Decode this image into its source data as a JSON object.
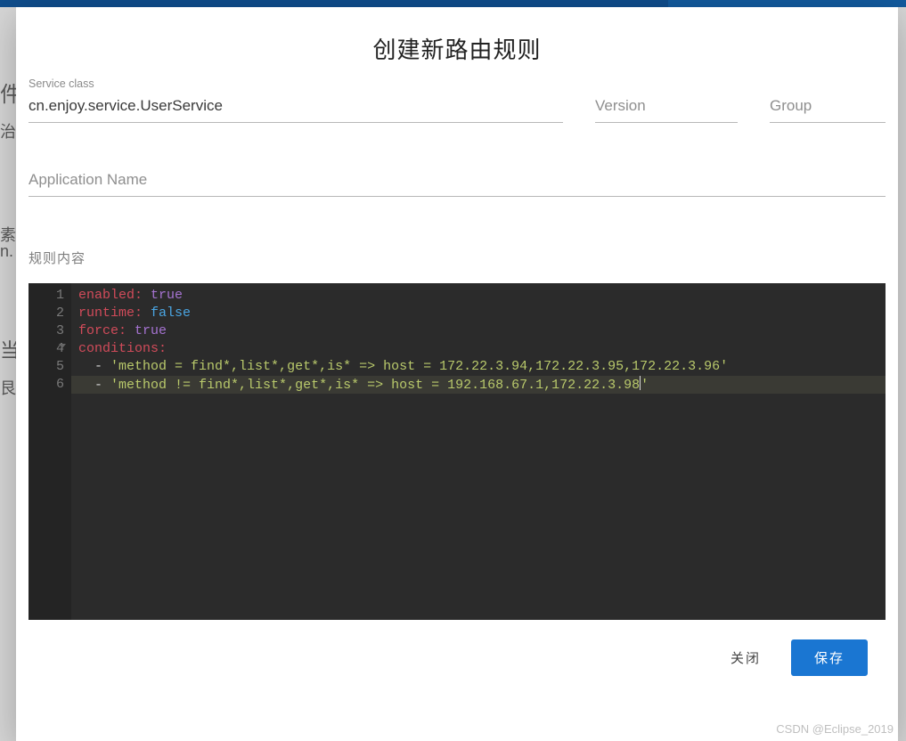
{
  "dialog": {
    "title": "创建新路由规则",
    "service": {
      "label": "Service class",
      "value": "cn.enjoy.service.UserService"
    },
    "version": {
      "placeholder": "Version",
      "value": ""
    },
    "group": {
      "placeholder": "Group",
      "value": ""
    },
    "appName": {
      "placeholder": "Application Name",
      "value": ""
    },
    "ruleLabel": "规则内容",
    "editor": {
      "lines": [
        {
          "n": 1,
          "tokens": [
            {
              "t": "enabled:",
              "c": "key"
            },
            {
              "t": " ",
              "c": ""
            },
            {
              "t": "true",
              "c": "true"
            }
          ]
        },
        {
          "n": 2,
          "tokens": [
            {
              "t": "runtime:",
              "c": "key"
            },
            {
              "t": " ",
              "c": ""
            },
            {
              "t": "false",
              "c": "false"
            }
          ]
        },
        {
          "n": 3,
          "tokens": [
            {
              "t": "force:",
              "c": "key"
            },
            {
              "t": " ",
              "c": ""
            },
            {
              "t": "true",
              "c": "true"
            }
          ]
        },
        {
          "n": 4,
          "fold": true,
          "tokens": [
            {
              "t": "conditions:",
              "c": "key"
            }
          ]
        },
        {
          "n": 5,
          "tokens": [
            {
              "t": "  ",
              "c": ""
            },
            {
              "t": "- ",
              "c": "dash"
            },
            {
              "t": "'method = find*,list*,get*,is* => host = 172.22.3.94,172.22.3.95,172.22.3.96'",
              "c": "str"
            }
          ]
        },
        {
          "n": 6,
          "hl": true,
          "tokens": [
            {
              "t": "  ",
              "c": ""
            },
            {
              "t": "- ",
              "c": "dash"
            },
            {
              "t": "'method != find*,list*,get*,is* => host = 192.168.67.1,172.22.3.98",
              "c": "str"
            },
            {
              "t": "CURSOR",
              "c": "cursor"
            },
            {
              "t": "'",
              "c": "str"
            }
          ]
        }
      ]
    },
    "actions": {
      "close": "关闭",
      "save": "保存"
    }
  },
  "watermark": "CSDN @Eclipse_2019",
  "bg": {
    "p1": "件",
    "p2": "治",
    "p3": "素",
    "p4": "n.",
    "p5": "当",
    "p6": "艮"
  }
}
